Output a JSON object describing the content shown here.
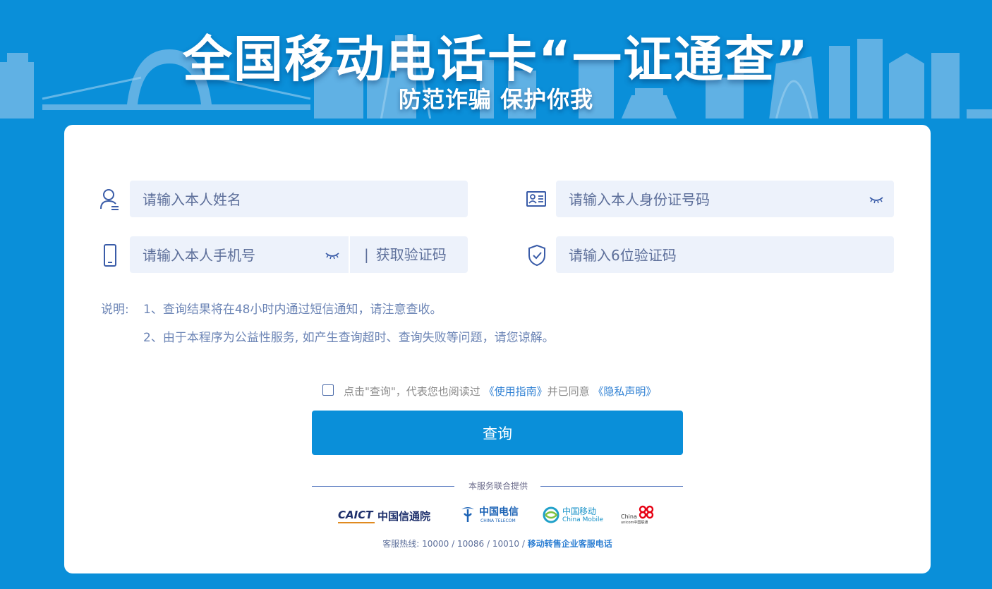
{
  "banner": {
    "title": "全国移动电话卡“一证通查”",
    "subtitle": "防范诈骗 保护你我"
  },
  "form": {
    "name_placeholder": "请输入本人姓名",
    "id_placeholder": "请输入本人身份证号码",
    "phone_placeholder": "请输入本人手机号",
    "get_code_label": "获取验证码",
    "get_code_separator": "|",
    "code_placeholder": "请输入6位验证码"
  },
  "notes": {
    "label": "说明:",
    "items": [
      "1、查询结果将在48小时内通过短信通知，请注意查收。",
      "2、由于本程序为公益性服务, 如产生查询超时、查询失败等问题，请您谅解。"
    ]
  },
  "agreement": {
    "prefix": "点击\"查询\"，代表您也阅读过",
    "guide_link": "《使用指南》",
    "middle": "并已同意",
    "privacy_link": "《隐私声明》"
  },
  "submit_label": "查询",
  "providers": {
    "label": "本服务联合提供",
    "logos": [
      {
        "name": "CAICT",
        "text": "CAICT",
        "sub": "中国信通院"
      },
      {
        "name": "China Telecom",
        "text": "中国电信",
        "sub": "CHINA TELECOM"
      },
      {
        "name": "China Mobile",
        "text": "中国移动",
        "sub": "China Mobile"
      },
      {
        "name": "China Unicom",
        "text": "China",
        "sub": "unicom中国联通"
      }
    ]
  },
  "hotline": {
    "text": "客服热线: 10000 / 10086 / 10010 /",
    "link": "移动转售企业客服电话"
  },
  "colors": {
    "background": "#0a8fd9",
    "field_bg": "#edf2fb",
    "icon": "#3a5ca8",
    "link": "#2d7fd3"
  }
}
